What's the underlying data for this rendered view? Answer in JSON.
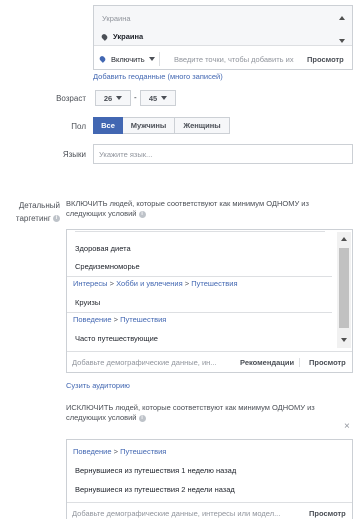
{
  "location": {
    "group_label": "Украина",
    "selected": "Украина",
    "include_label": "Включить",
    "input_placeholder": "Введите точки, чтобы добавить их",
    "browse_label": "Просмотр",
    "bulk_link": "Добавить геоданные (много записей)"
  },
  "age": {
    "label": "Возраст",
    "min": "26",
    "separator": "-",
    "max": "45"
  },
  "gender": {
    "label": "Пол",
    "options": [
      "Все",
      "Мужчины",
      "Женщины"
    ],
    "selected": "Все"
  },
  "languages": {
    "label": "Языки",
    "placeholder": "Укажите язык..."
  },
  "detailed": {
    "label_line1": "Детальный",
    "label_line2": "таргетинг",
    "include_text_line1": "ВКЛЮЧИТЬ людей, которые соответствуют как минимум ОДНОМУ из",
    "include_text_line2": "следующих условий",
    "include_items": [
      {
        "type": "item",
        "text": "Здоровая диета"
      },
      {
        "type": "item",
        "text": "Средиземноморье"
      },
      {
        "type": "path",
        "parts": [
          "Интересы",
          "Хобби и увлечения",
          "Путешествия"
        ]
      },
      {
        "type": "item",
        "text": "Круизы"
      },
      {
        "type": "path",
        "parts": [
          "Поведение",
          "Путешествия"
        ]
      },
      {
        "type": "item",
        "text": "Часто путешествующие"
      }
    ],
    "input_placeholder": "Добавьте демографические данные, ин...",
    "recommendations_label": "Рекомендации",
    "browse_label": "Просмотр",
    "narrow_link": "Сузить аудиторию",
    "exclude_text_line1": "ИСКЛЮЧИТЬ людей, которые соответствуют как минимум ОДНОМУ из",
    "exclude_text_line2": "следующих условий",
    "exclude_close": "×",
    "exclude_path": [
      "Поведение",
      "Путешествия"
    ],
    "exclude_items": [
      "Вернувшиеся из путешествия 1 неделю назад",
      "Вернувшиеся из путешествия 2 недели назад"
    ],
    "exclude_input_placeholder": "Добавьте демографические данные, интересы или модел...",
    "exclude_browse_label": "Просмотр"
  },
  "colors": {
    "accent": "#4267b2",
    "border": "#ccd0d5"
  }
}
